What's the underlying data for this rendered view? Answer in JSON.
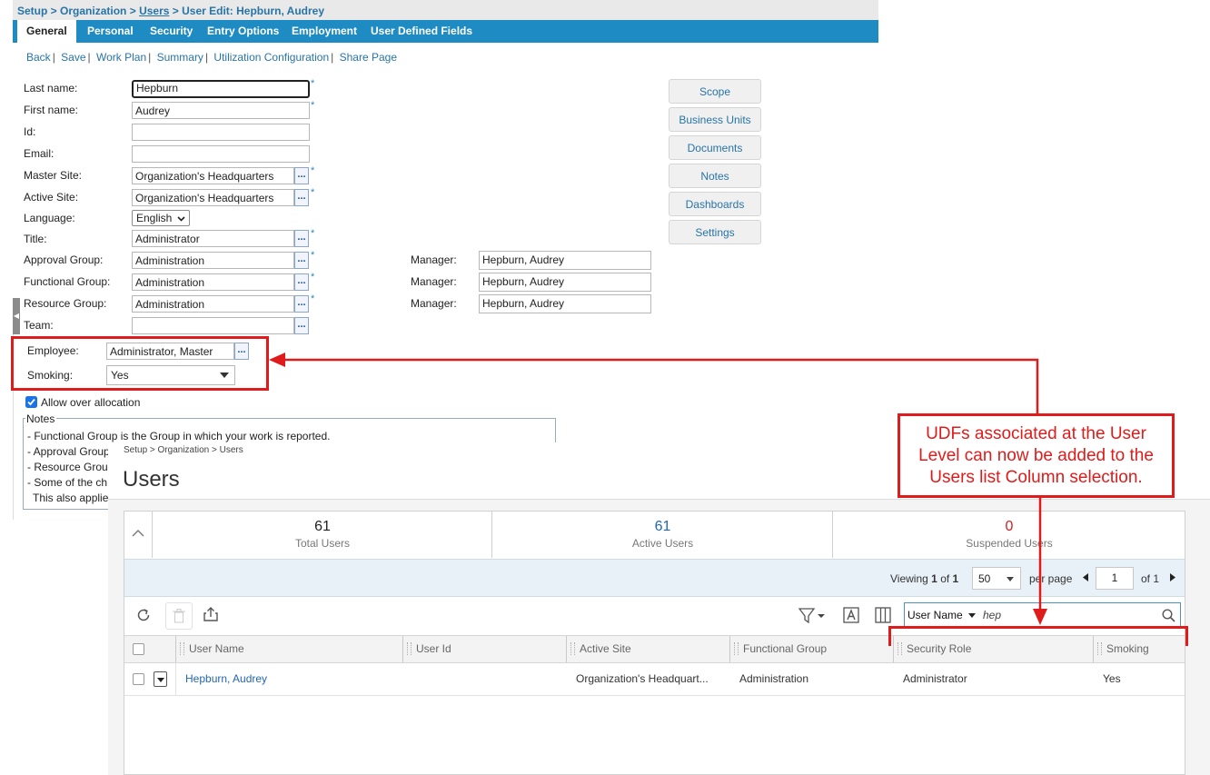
{
  "edit": {
    "breadcrumb": {
      "setup": "Setup",
      "sep1": " > ",
      "organization": "Organization",
      "sep2": " > ",
      "users": "Users",
      "sep3": " > ",
      "current": "User Edit: Hepburn, Audrey"
    },
    "tabs": [
      "General",
      "Personal",
      "Security",
      "Entry Options",
      "Employment",
      "User Defined Fields"
    ],
    "actions": [
      "Back",
      "Save",
      "Work Plan",
      "Summary",
      "Utilization Configuration",
      "Share Page"
    ],
    "fields": {
      "last_name": {
        "label": "Last name:",
        "value": "Hepburn"
      },
      "first_name": {
        "label": "First name:",
        "value": "Audrey"
      },
      "id": {
        "label": "Id:",
        "value": ""
      },
      "email": {
        "label": "Email:",
        "value": ""
      },
      "master_site": {
        "label": "Master Site:",
        "value": "Organization's Headquarters"
      },
      "active_site": {
        "label": "Active Site:",
        "value": "Organization's Headquarters"
      },
      "language": {
        "label": "Language:",
        "value": "English"
      },
      "title": {
        "label": "Title:",
        "value": "Administrator"
      },
      "approval_group": {
        "label": "Approval Group:",
        "value": "Administration",
        "manager_label": "Manager:",
        "manager": "Hepburn, Audrey"
      },
      "functional_group": {
        "label": "Functional Group:",
        "value": "Administration",
        "manager_label": "Manager:",
        "manager": "Hepburn, Audrey"
      },
      "resource_group": {
        "label": "Resource Group:",
        "value": "Administration",
        "manager_label": "Manager:",
        "manager": "Hepburn, Audrey"
      },
      "team": {
        "label": "Team:",
        "value": ""
      },
      "employee": {
        "label": "Employee:",
        "value": "Administrator, Master"
      },
      "smoking": {
        "label": "Smoking:",
        "value": "Yes"
      }
    },
    "required_mark": "*",
    "dots": "...",
    "allow_over_allocation": {
      "label": "Allow over allocation",
      "checked": true
    },
    "notes": {
      "legend": "Notes",
      "lines": [
        "- Functional Group is the Group in which your work is reported.",
        "- Approval Group",
        "- Resource Grou",
        "- Some of the ch",
        "This also applie"
      ]
    },
    "side_buttons": [
      "Scope",
      "Business Units",
      "Documents",
      "Notes",
      "Dashboards",
      "Settings"
    ]
  },
  "users": {
    "breadcrumb": "Setup > Organization > Users",
    "title": "Users",
    "stats": [
      {
        "value": "61",
        "label": "Total Users",
        "color": "#222222"
      },
      {
        "value": "61",
        "label": "Active Users",
        "color": "#2167b1"
      },
      {
        "value": "0",
        "label": "Suspended Users",
        "color": "#d31f1f"
      }
    ],
    "pager": {
      "viewing_label": "Viewing",
      "from": "1",
      "of_label": "of",
      "to": "1",
      "per_page_value": "50",
      "per_page_label": "per page",
      "page": "1",
      "of_pages": "of 1"
    },
    "search": {
      "field": "User Name",
      "value": "hep"
    },
    "columns": [
      "User Name",
      "User Id",
      "Active Site",
      "Functional Group",
      "Security Role",
      "Smoking"
    ],
    "rows": [
      {
        "user_name": "Hepburn, Audrey",
        "user_id": "",
        "active_site": "Organization's Headquart...",
        "functional_group": "Administration",
        "security_role": "Administrator",
        "smoking": "Yes"
      }
    ]
  },
  "annotation": {
    "text": "UDFs associated at the User Level can now be added to the Users list Column selection."
  },
  "colors": {
    "annotation_red": "#e01b1b",
    "tab_blue": "#1e8bc3",
    "link_blue": "#2874a6"
  }
}
